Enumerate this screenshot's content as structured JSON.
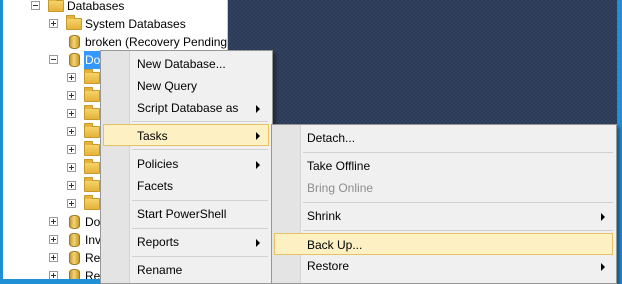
{
  "tree": {
    "root_label": "Databases",
    "system_databases": "System Databases",
    "broken_db": "broken (Recovery Pending)",
    "selected_db": "Dot",
    "lower_items": [
      "Dot",
      "Inv",
      "Rep",
      "Rep"
    ]
  },
  "context_menu": {
    "new_database": "New Database...",
    "new_query": "New Query",
    "script_database_as": "Script Database as",
    "tasks": "Tasks",
    "policies": "Policies",
    "facets": "Facets",
    "start_powershell": "Start PowerShell",
    "reports": "Reports",
    "rename": "Rename"
  },
  "tasks_menu": {
    "detach": "Detach...",
    "take_offline": "Take Offline",
    "bring_online": "Bring Online",
    "shrink": "Shrink",
    "back_up": "Back Up...",
    "restore": "Restore"
  }
}
